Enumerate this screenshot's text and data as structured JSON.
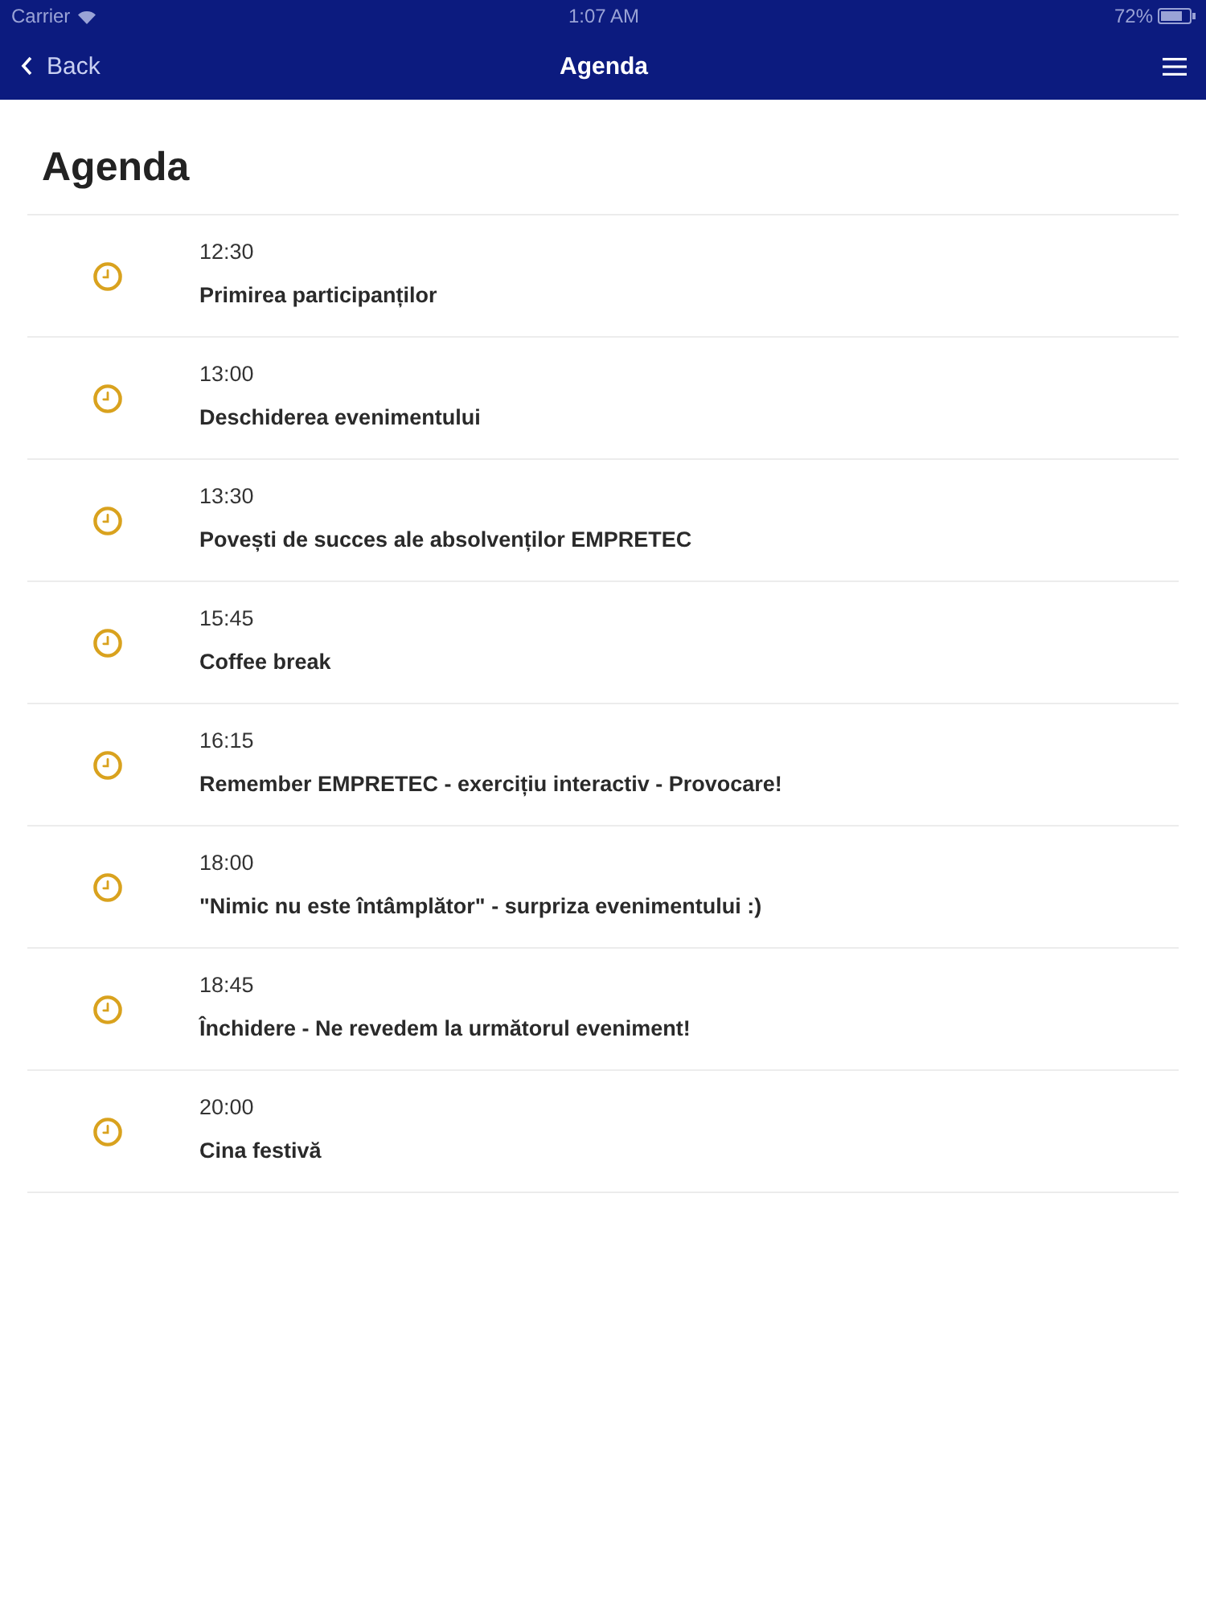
{
  "status_bar": {
    "carrier": "Carrier",
    "time": "1:07 AM",
    "battery": "72%"
  },
  "nav_bar": {
    "back": "Back",
    "title": "Agenda"
  },
  "page_title": "Agenda",
  "agenda": [
    {
      "time": "12:30",
      "title": "Primirea participanților"
    },
    {
      "time": "13:00",
      "title": "Deschiderea evenimentului"
    },
    {
      "time": "13:30",
      "title": "Povești de succes ale absolvenților EMPRETEC"
    },
    {
      "time": "15:45",
      "title": "Coffee break"
    },
    {
      "time": "16:15",
      "title": "Remember EMPRETEC - exercițiu interactiv - Provocare!"
    },
    {
      "time": "18:00",
      "title": "\"Nimic nu este întâmplător\" - surpriza evenimentului :)"
    },
    {
      "time": "18:45",
      "title": "Închidere - Ne revedem la următorul eveniment!"
    },
    {
      "time": "20:00",
      "title": "Cina festivă"
    }
  ]
}
